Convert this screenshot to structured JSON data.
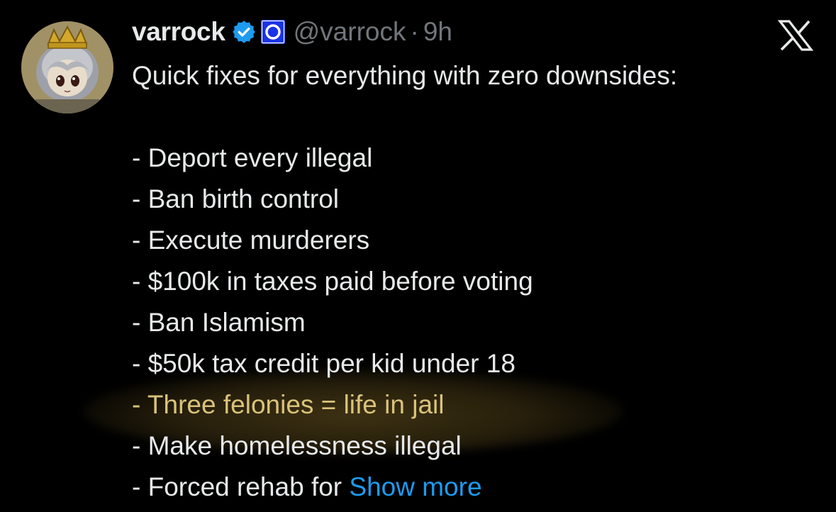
{
  "tweet": {
    "display_name": "varrock",
    "handle": "@varrock",
    "separator": "·",
    "time": "9h",
    "intro": "Quick fixes for everything with zero downsides:",
    "items": [
      "- Deport every illegal",
      "- Ban birth control",
      "- Execute murderers",
      "- $100k in taxes paid before voting",
      "- Ban Islamism",
      "- $50k tax credit per kid under 18",
      "- Three felonies = life in jail",
      "- Make homelessness illegal"
    ],
    "last_item_prefix": "- Forced rehab for ",
    "show_more_label": "Show more"
  },
  "icons": {
    "verified": "verified-badge-icon",
    "affiliate": "affiliate-o-icon",
    "platform": "x-logo-icon"
  },
  "colors": {
    "background": "#000000",
    "text": "#e7e9ea",
    "secondary": "#71767b",
    "link": "#1d9bf0",
    "verified": "#1d9bf0",
    "highlight_text": "#d9c37a"
  }
}
